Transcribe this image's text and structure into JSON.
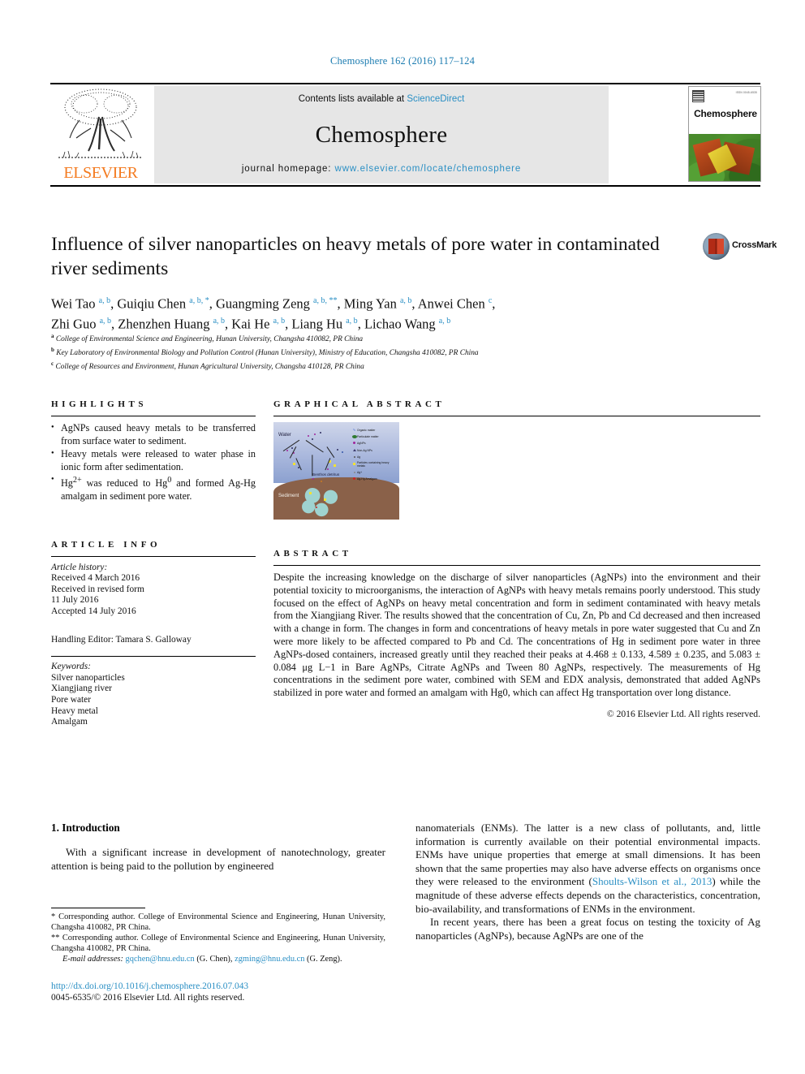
{
  "running_head": "Chemosphere 162 (2016) 117–124",
  "masthead": {
    "contents_prefix": "Contents lists available at ",
    "contents_link": "ScienceDirect",
    "journal_name": "Chemosphere",
    "homepage_prefix": "journal homepage: ",
    "homepage_url": "www.elsevier.com/locate/chemosphere",
    "publisher": "ELSEVIER",
    "cover_title": "Chemosphere",
    "cover_tiny_text": "ISSN 0045-6535"
  },
  "crossmark": {
    "label": "CrossMark"
  },
  "article": {
    "title": "Influence of silver nanoparticles on heavy metals of pore water in contaminated river sediments",
    "authors_line1": "Wei Tao a, b, Guiqiu Chen a, b, *, Guangming Zeng a, b, **, Ming Yan a, b, Anwei Chen c,",
    "authors_line2": "Zhi Guo a, b, Zhenzhen Huang a, b, Kai He a, b, Liang Hu a, b, Lichao Wang a, b",
    "affiliations": [
      {
        "marker": "a",
        "text": "College of Environmental Science and Engineering, Hunan University, Changsha 410082, PR China"
      },
      {
        "marker": "b",
        "text": "Key Laboratory of Environmental Biology and Pollution Control (Hunan University), Ministry of Education, Changsha 410082, PR China"
      },
      {
        "marker": "c",
        "text": "College of Resources and Environment, Hunan Agricultural University, Changsha 410128, PR China"
      }
    ]
  },
  "highlights": {
    "heading": "HIGHLIGHTS",
    "items": [
      "AgNPs caused heavy metals to be transferred from surface water to sediment.",
      "Heavy metals were released to water phase in ionic form after sedimentation.",
      "Hg2+ was reduced to Hg0 and formed Ag-Hg amalgam in sediment pore water."
    ],
    "item3_parts": {
      "pre": "Hg",
      "sup1": "2+",
      "mid": " was reduced to Hg",
      "sup2": "0",
      "post": " and formed Ag-Hg amalgam in sediment pore water."
    }
  },
  "graphical_abstract": {
    "heading": "GRAPHICAL ABSTRACT",
    "figure_labels": {
      "water": "Water",
      "sediment": "Sediment",
      "middle": "Benthos detritus"
    },
    "legend": [
      "Organic matter",
      "Particulate matter",
      "AgNPs",
      "Non-Ag NPs",
      "Ag",
      "Particles containing heavy metals",
      "Ag+",
      "Ag-Hg Amalgam"
    ]
  },
  "article_info": {
    "heading": "ARTICLE INFO",
    "history_label": "Article history:",
    "history": [
      "Received 4 March 2016",
      "Received in revised form",
      "11 July 2016",
      "Accepted 14 July 2016"
    ],
    "handling_editor": "Handling Editor: Tamara S. Galloway",
    "keywords_label": "Keywords:",
    "keywords": [
      "Silver nanoparticles",
      "Xiangjiang river",
      "Pore water",
      "Heavy metal",
      "Amalgam"
    ]
  },
  "abstract": {
    "heading": "ABSTRACT",
    "text": "Despite the increasing knowledge on the discharge of silver nanoparticles (AgNPs) into the environment and their potential toxicity to microorganisms, the interaction of AgNPs with heavy metals remains poorly understood. This study focused on the effect of AgNPs on heavy metal concentration and form in sediment contaminated with heavy metals from the Xiangjiang River. The results showed that the concentration of Cu, Zn, Pb and Cd decreased and then increased with a change in form. The changes in form and concentrations of heavy metals in pore water suggested that Cu and Zn were more likely to be affected compared to Pb and Cd. The concentrations of Hg in sediment pore water in three AgNPs-dosed containers, increased greatly until they reached their peaks at 4.468 ± 0.133, 4.589 ± 0.235, and 5.083 ± 0.084 μg L−1 in Bare AgNPs, Citrate AgNPs and Tween 80 AgNPs, respectively. The measurements of Hg concentrations in the sediment pore water, combined with SEM and EDX analysis, demonstrated that added AgNPs stabilized in pore water and formed an amalgam with Hg0, which can affect Hg transportation over long distance.",
    "copyright": "© 2016 Elsevier Ltd. All rights reserved."
  },
  "introduction": {
    "heading": "1. Introduction",
    "col_left_p1": "With a significant increase in development of nanotechnology, greater attention is being paid to the pollution by engineered",
    "col_right_p1_a": "nanomaterials (ENMs). The latter is a new class of pollutants, and, little information is currently available on their potential environmental impacts. ENMs have unique properties that emerge at small dimensions. It has been shown that the same properties may also have adverse effects on organisms once they were released to the environment (",
    "col_right_p1_cite": "Shoults-Wilson et al., 2013",
    "col_right_p1_b": ") while the magnitude of these adverse effects depends on the characteristics, concentration, bio-availability, and transformations of ENMs in the environment.",
    "col_right_p2": "In recent years, there has been a great focus on testing the toxicity of Ag nanoparticles (AgNPs), because AgNPs are one of the"
  },
  "footnotes": {
    "corr1_marker": "*",
    "corr1": "Corresponding author. College of Environmental Science and Engineering, Hunan University, Changsha 410082, PR China.",
    "corr2_marker": "**",
    "corr2": "Corresponding author. College of Environmental Science and Engineering, Hunan University, Changsha 410082, PR China.",
    "email_label": "E-mail addresses:",
    "email1": "gqchen@hnu.edu.cn",
    "email1_name": "(G. Chen),",
    "email2": "zgming@hnu.edu.cn",
    "email2_name": "(G. Zeng)."
  },
  "doi_block": {
    "doi": "http://dx.doi.org/10.1016/j.chemosphere.2016.07.043",
    "issn": "0045-6535/© 2016 Elsevier Ltd. All rights reserved."
  },
  "colors": {
    "link": "#2a8fc4",
    "elsevier_orange": "#F47B20",
    "band_gray": "#e6e6e6"
  }
}
